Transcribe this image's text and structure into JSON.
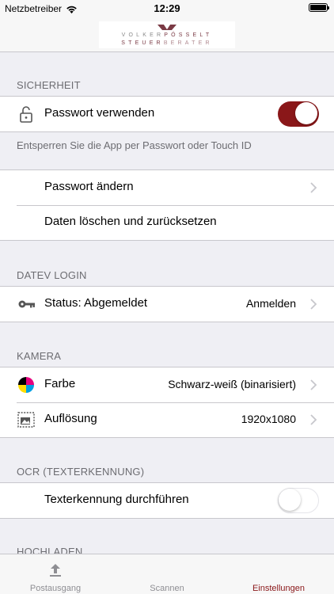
{
  "status_bar": {
    "carrier": "Netzbetreiber",
    "time": "12:29"
  },
  "logo": {
    "line1_light": "VOLKER",
    "line1_strong": "PÖSSELT",
    "line2_strong": "STEUER",
    "line2_light": "BERATER"
  },
  "sections": {
    "security": {
      "header": "SICHERHEIT",
      "use_password_label": "Passwort verwenden",
      "use_password_on": true,
      "footer": "Entsperren Sie die App per Passwort oder Touch ID",
      "change_password_label": "Passwort ändern",
      "reset_label": "Daten löschen und zurücksetzen"
    },
    "datev": {
      "header": "DATEV LOGIN",
      "status_label": "Status: Abgemeldet",
      "action_value": "Anmelden"
    },
    "camera": {
      "header": "KAMERA",
      "color_label": "Farbe",
      "color_value": "Schwarz-weiß (binarisiert)",
      "resolution_label": "Auflösung",
      "resolution_value": "1920x1080"
    },
    "ocr": {
      "header": "OCR (TEXTERKENNUNG)",
      "run_ocr_label": "Texterkennung durchführen",
      "run_ocr_on": false
    },
    "upload": {
      "header": "HOCHLADEN"
    }
  },
  "tabs": [
    {
      "label": "Postausgang",
      "icon": "upload-icon"
    },
    {
      "label": "Scannen",
      "icon": ""
    },
    {
      "label": "Einstellungen",
      "icon": ""
    }
  ],
  "colors": {
    "accent": "#8a1719",
    "secondary_text": "#6d6d72",
    "background": "#efeff4"
  }
}
